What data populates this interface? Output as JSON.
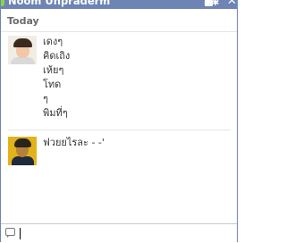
{
  "titlebar": {
    "title": "Noom Unpraderm",
    "icons": [
      "video-icon",
      "gear-icon",
      "close-icon"
    ],
    "close_glyph": "✕",
    "gear_glyph": "✱",
    "color": "#6d84b4"
  },
  "conversation": {
    "day_label": "Today",
    "messages": [
      {
        "avatar": "friend-avatar",
        "lines": [
          "เดงๆ",
          "คิดเถิง",
          "เห้ยๆ",
          "โทด",
          "ๆ",
          "พิมที่ๆ"
        ]
      },
      {
        "avatar": "self-avatar",
        "lines": [
          "ฟวยยไรละ - -'"
        ]
      }
    ]
  },
  "composer": {
    "placeholder": "",
    "value": ""
  }
}
